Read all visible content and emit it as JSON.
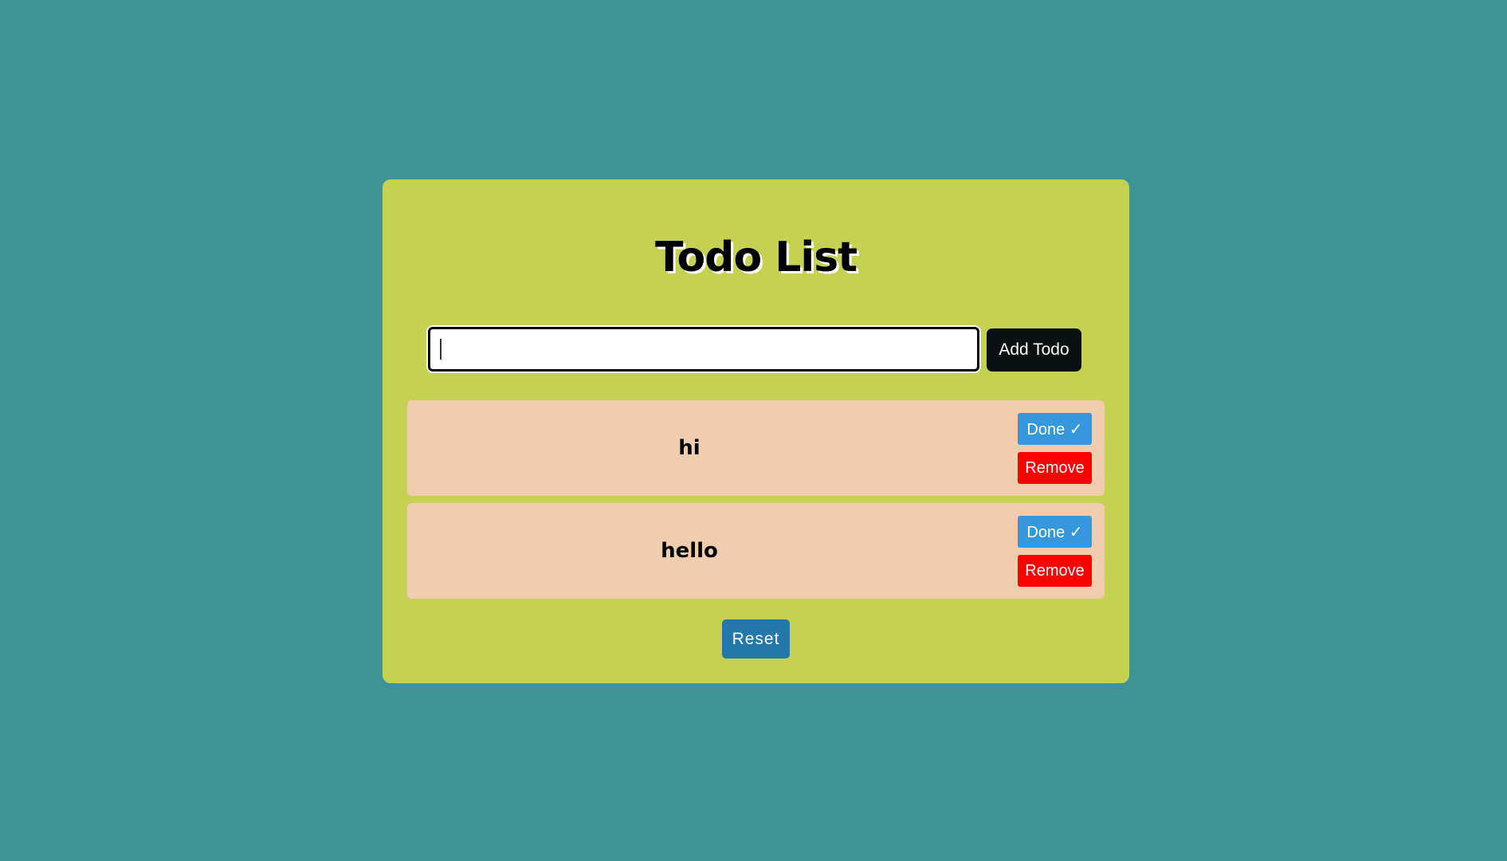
{
  "app": {
    "title": "Todo List"
  },
  "input": {
    "value": "",
    "placeholder": ""
  },
  "buttons": {
    "add_label": "Add Todo",
    "reset_label": "Reset"
  },
  "todos": [
    {
      "text": "hi",
      "done_label": "Done ✓",
      "remove_label": "Remove"
    },
    {
      "text": "hello",
      "done_label": "Done ✓",
      "remove_label": "Remove"
    }
  ],
  "colors": {
    "background": "#3e9494",
    "card": "#c5d152",
    "todo_item": "#f0cdae",
    "add_button": "#0b1111",
    "done_button": "#3498db",
    "remove_button": "#ff0000",
    "reset_button": "#2278aa"
  }
}
